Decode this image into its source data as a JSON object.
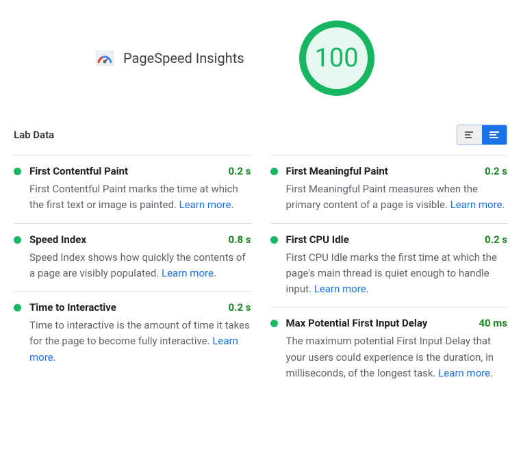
{
  "brand": {
    "title": "PageSpeed Insights"
  },
  "score": {
    "value": "100"
  },
  "section": {
    "title": "Lab Data"
  },
  "learn_more": "Learn more",
  "metrics_left": [
    {
      "title": "First Contentful Paint",
      "value": "0.2 s",
      "desc": "First Contentful Paint marks the time at which the first text or image is painted. "
    },
    {
      "title": "Speed Index",
      "value": "0.8 s",
      "desc": "Speed Index shows how quickly the contents of a page are visibly populated. "
    },
    {
      "title": "Time to Interactive",
      "value": "0.2 s",
      "desc": "Time to interactive is the amount of time it takes for the page to become fully interactive. "
    }
  ],
  "metrics_right": [
    {
      "title": "First Meaningful Paint",
      "value": "0.2 s",
      "desc": "First Meaningful Paint measures when the primary content of a page is visible. "
    },
    {
      "title": "First CPU Idle",
      "value": "0.2 s",
      "desc": "First CPU Idle marks the first time at which the page's main thread is quiet enough to handle input. "
    },
    {
      "title": "Max Potential First Input Delay",
      "value": "40 ms",
      "desc": "The maximum potential First Input Delay that your users could experience is the duration, in milliseconds, of the longest task. "
    }
  ]
}
